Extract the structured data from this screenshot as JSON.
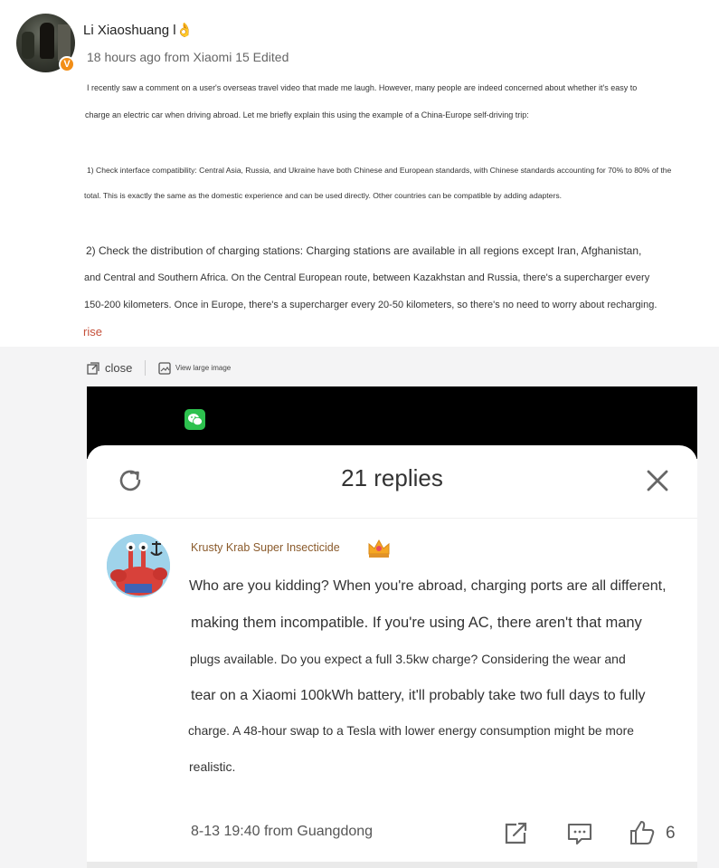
{
  "post": {
    "username": "Li Xiaoshuang l",
    "username_emoji": "👌",
    "meta": "18 hours ago from Xiaomi 15 Edited",
    "verified_badge": "V",
    "lines": [
      "I recently saw a comment on a user's overseas travel video that made me laugh. However, many people are indeed concerned about whether it's easy to",
      "charge an electric car when driving abroad. Let me briefly explain this using the example of a China-Europe self-driving trip:",
      "1) Check interface compatibility: Central Asia, Russia, and Ukraine have both Chinese and European standards, with Chinese standards accounting for 70% to 80% of the",
      "total. This is exactly the same as the domestic experience and can be used directly. Other countries can be compatible by adding adapters.",
      "2) Check the distribution of charging stations: Charging stations are available in all regions except Iran, Afghanistan,",
      "and Central and Southern Africa. On the Central European route, between Kazakhstan and Russia, there's a supercharger every",
      "150-200 kilometers. Once in Europe, there's a supercharger every 20-50 kilometers, so there's no need to worry about recharging."
    ],
    "rise_label": "rise"
  },
  "toolbar": {
    "close_label": "close",
    "view_large_label": "View large image"
  },
  "screenshot": {
    "replies_title": "21 replies",
    "comment": {
      "author": "Krusty Krab Super Insecticide",
      "lines": [
        "Who are you kidding? When you're abroad, charging ports are all different,",
        "making them incompatible. If you're using AC, there aren't that many",
        "plugs available. Do you expect a full 3.5kw charge? Considering the wear and",
        "tear on a Xiaomi 100kWh battery, it'll probably take two full days to fully",
        "charge. A 48-hour swap to a Tesla with lower energy consumption might be more",
        "realistic."
      ],
      "footer": "8-13 19:40 from Guangdong",
      "like_count": "6"
    }
  },
  "colors": {
    "accent_orange": "#f28e16",
    "rise_red": "#c5503a",
    "author_brown": "#8a5a2b",
    "wechat_green": "#2dc14e"
  },
  "icons": [
    "reload-icon",
    "close-icon",
    "share-icon",
    "comment-icon",
    "thumbs-up-icon",
    "wechat-icon",
    "crown-icon",
    "expand-icon",
    "image-icon"
  ]
}
